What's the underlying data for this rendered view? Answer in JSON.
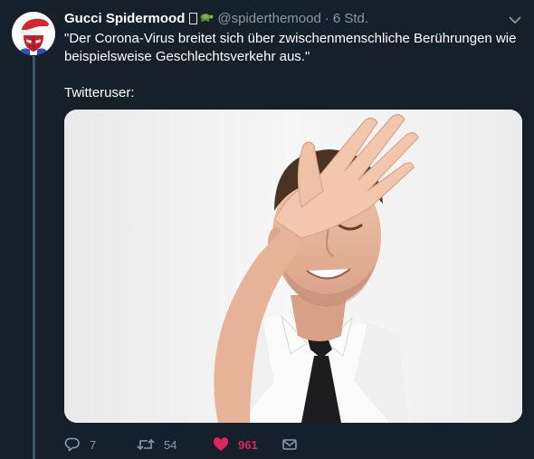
{
  "tweet": {
    "display_name": "Gucci Spidermood",
    "name_emoji": "🐢",
    "handle": "@spiderthemood",
    "separator": "·",
    "time": "6 Std.",
    "text_line1": "\"Der Corona-Virus breitet sich über zwischenmenschliche Berührungen wie beispielsweise Geschlechtsverkehr aus.\"",
    "text_line2": "Twitteruser:"
  },
  "icons": {
    "caret": "chevron-down-icon",
    "reply": "reply-icon",
    "retweet": "retweet-icon",
    "like": "heart-icon",
    "share": "mail-icon"
  },
  "actions": {
    "reply_count": "7",
    "retweet_count": "54",
    "like_count": "961"
  },
  "colors": {
    "background": "#15202b",
    "text": "#ffffff",
    "muted": "#8899a6",
    "like": "#e0245e",
    "thread_line": "#3d5466"
  }
}
